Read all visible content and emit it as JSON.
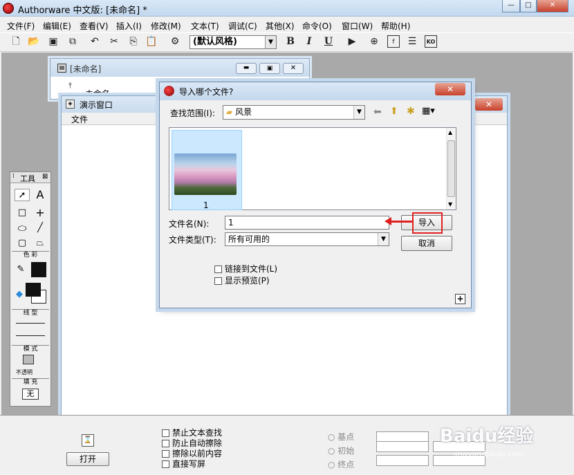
{
  "app": {
    "title": "Authorware 中文版: [未命名] *",
    "caption_buttons": [
      "—",
      "□",
      "✕"
    ]
  },
  "menu": [
    "文件(F)",
    "编辑(E)",
    "查看(V)",
    "插入(I)",
    "修改(M)",
    "文本(T)",
    "调试(C)",
    "其他(X)",
    "命令(O)",
    "窗口(W)",
    "帮助(H)"
  ],
  "toolbar": {
    "style_value": "(默认风格)",
    "bold": "B",
    "italic": "I",
    "underline": "U"
  },
  "design_window": {
    "title": "[未命名]",
    "flow_item": "未命名"
  },
  "presentation_window": {
    "title": "演示窗口",
    "menu_file": "文件"
  },
  "tools": {
    "title": "工具",
    "color_label": "色 彩",
    "line_label": "线 型",
    "mode_label": "模 式",
    "mode_value": "不透明",
    "fill_label": "填 充",
    "fill_value": "无",
    "text_tool": "A"
  },
  "lower_panel": {
    "open_button": "打开",
    "checkboxes": [
      "禁止文本查找",
      "防止自动擦除",
      "擦除以前内容",
      "直接写屏"
    ],
    "radios": [
      "基点",
      "初始",
      "终点"
    ]
  },
  "dialog": {
    "title": "导入哪个文件?",
    "look_in_label": "查找范围(I):",
    "look_in_value": "风景",
    "file_name_label": "文件名(N):",
    "file_name_value": "1",
    "file_type_label": "文件类型(T):",
    "file_type_value": "所有可用的",
    "import_button": "导入",
    "cancel_button": "取消",
    "link_checkbox": "链接到文件(L)",
    "preview_checkbox": "显示预览(P)",
    "plus": "+",
    "files": [
      {
        "name": "1"
      }
    ]
  },
  "watermark": {
    "brand": "Baidu经验",
    "url": "jingyan.baidu.com"
  },
  "colors": {
    "accent_red": "#e02020",
    "selection": "#cce8ff"
  }
}
